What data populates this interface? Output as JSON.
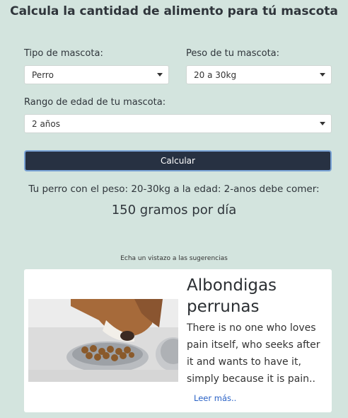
{
  "page": {
    "title": "Calcula la cantidad de alimento para tú mascota"
  },
  "form": {
    "pet_type_label": "Tipo de mascota:",
    "pet_type_value": "Perro",
    "weight_label": "Peso de tu mascota:",
    "weight_value": "20 a 30kg",
    "age_label": "Rango de edad de tu mascota:",
    "age_value": "2 años",
    "calculate_button": "Calcular"
  },
  "result": {
    "sentence": "Tu perro con el peso: 20-30kg a la edad: 2-anos debe comer:",
    "amount": "150 gramos por día"
  },
  "suggestions": {
    "heading": "Echa un vistazo a las sugerencias",
    "card": {
      "title": "Albondigas perrunas",
      "text": "There is no one who loves pain itself, who seeks after it and wants to have it, simply because it is pain..",
      "link": "Leer más.."
    }
  },
  "colors": {
    "background": "#d3e4de",
    "button_bg": "#273142",
    "link": "#2a62c6"
  }
}
